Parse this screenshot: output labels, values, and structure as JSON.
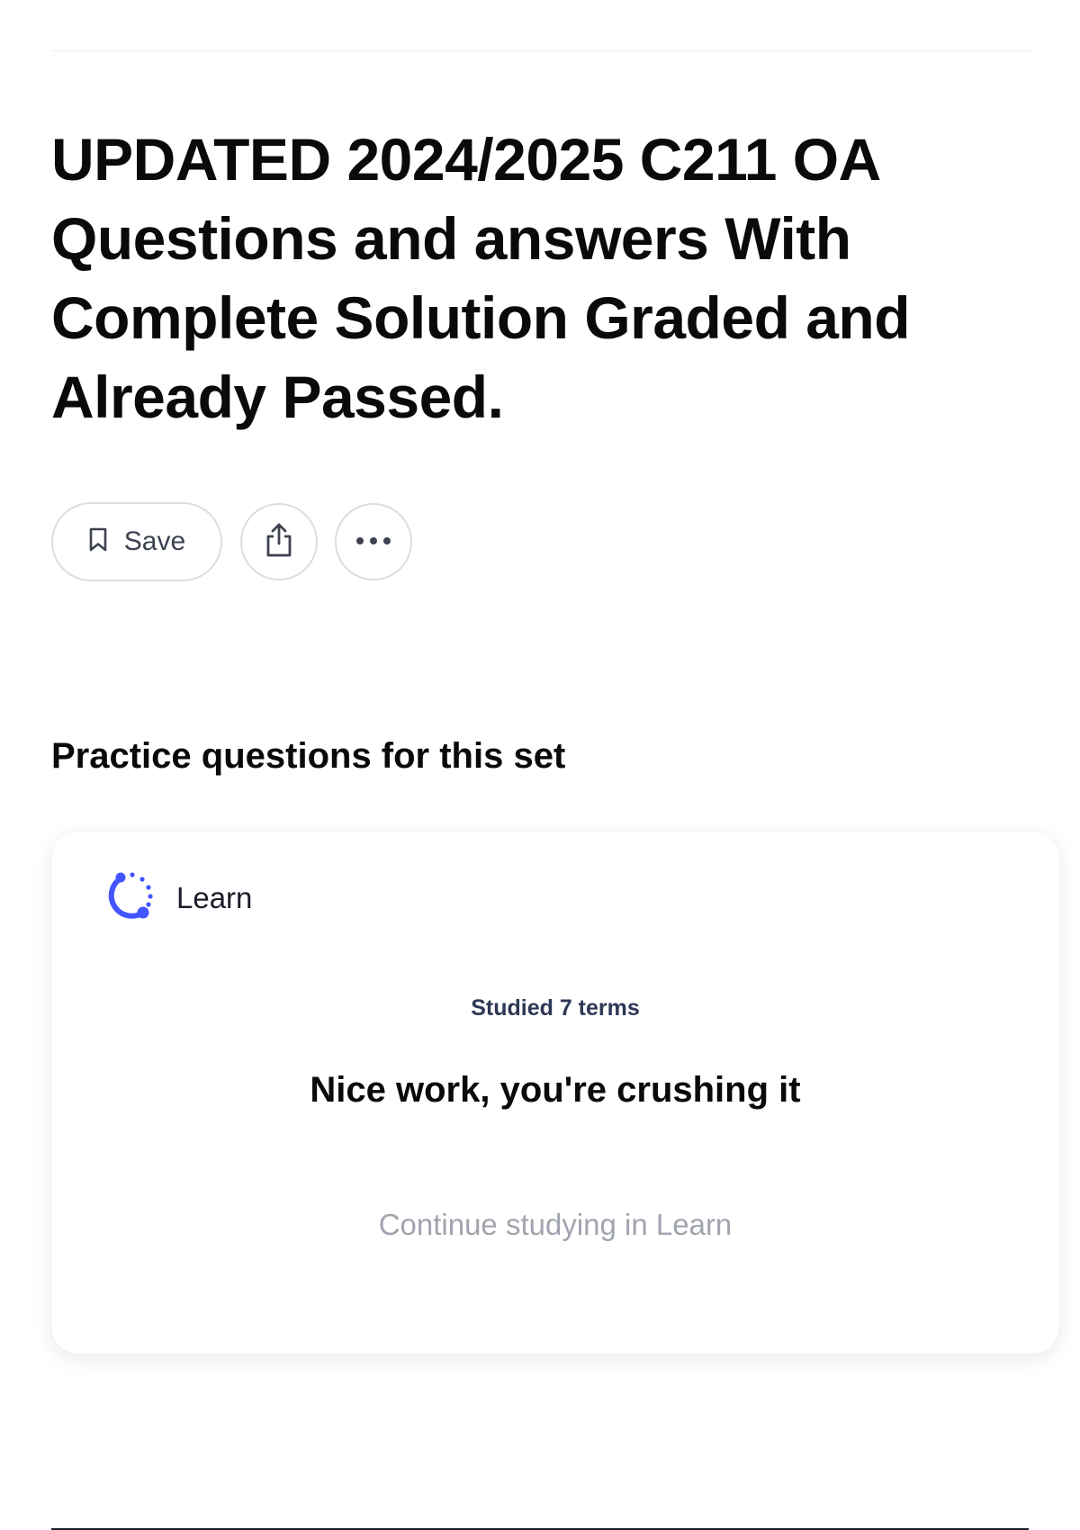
{
  "set": {
    "title": "UPDATED 2024/2025 C211 OA Questions and answers With Complete Solution Graded and Already Passed."
  },
  "actions": {
    "save_label": "Save",
    "share_icon": "share-icon",
    "more_icon": "more-options-icon"
  },
  "practice": {
    "heading": "Practice questions for this set",
    "card": {
      "mode_label": "Learn",
      "mode_icon": "learn-progress-icon",
      "studied_text": "Studied 7 terms",
      "message": "Nice work, you're crushing it",
      "continue_label": "Continue studying in Learn"
    }
  },
  "colors": {
    "accent": "#4255ff",
    "text_primary": "#0a0a0a",
    "text_muted": "#a0a4ad",
    "border": "#dcdde3"
  }
}
